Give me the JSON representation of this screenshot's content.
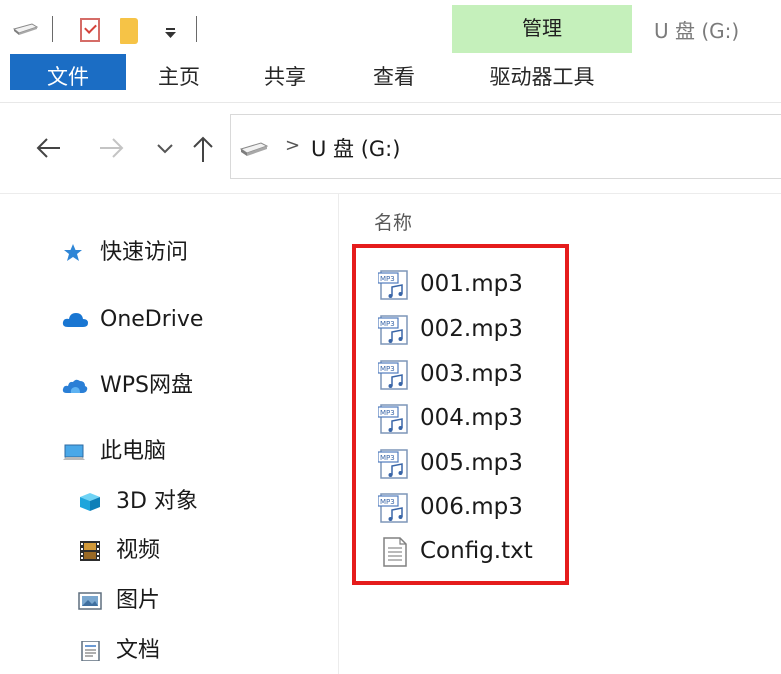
{
  "window": {
    "title": "U 盘 (G:)",
    "context_header": "管理"
  },
  "ribbon": {
    "tabs": [
      {
        "label": "文件",
        "active": true
      },
      {
        "label": "主页"
      },
      {
        "label": "共享"
      },
      {
        "label": "查看"
      },
      {
        "label": "驱动器工具"
      }
    ]
  },
  "address": {
    "separator": ">",
    "path": "U 盘 (G:)"
  },
  "nav_pane": {
    "items": [
      {
        "label": "快速访问",
        "icon": "star-pin-icon"
      },
      {
        "label": "OneDrive",
        "icon": "onedrive-cloud-icon"
      },
      {
        "label": "WPS网盘",
        "icon": "wps-cloud-icon"
      },
      {
        "label": "此电脑",
        "icon": "computer-icon"
      },
      {
        "label": "3D 对象",
        "icon": "3d-objects-icon"
      },
      {
        "label": "视频",
        "icon": "videos-icon"
      },
      {
        "label": "图片",
        "icon": "pictures-icon"
      },
      {
        "label": "文档",
        "icon": "documents-icon"
      }
    ]
  },
  "content": {
    "column_header": "名称",
    "files": [
      {
        "name": "001.mp3",
        "icon": "mp3-file-icon"
      },
      {
        "name": "002.mp3",
        "icon": "mp3-file-icon"
      },
      {
        "name": "003.mp3",
        "icon": "mp3-file-icon"
      },
      {
        "name": "004.mp3",
        "icon": "mp3-file-icon"
      },
      {
        "name": "005.mp3",
        "icon": "mp3-file-icon"
      },
      {
        "name": "006.mp3",
        "icon": "mp3-file-icon"
      },
      {
        "name": "Config.txt",
        "icon": "text-file-icon"
      }
    ]
  },
  "colors": {
    "file_tab": "#1b6dc4",
    "context_header": "#c5f0bb",
    "highlight_border": "#e51c1c"
  }
}
